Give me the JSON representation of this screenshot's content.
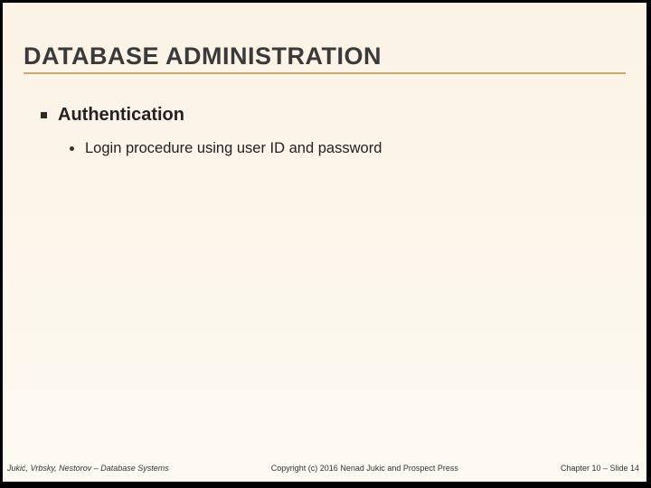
{
  "title": "DATABASE ADMINISTRATION",
  "bullets": {
    "l1": "Authentication",
    "l2": "Login procedure using user ID and password"
  },
  "footer": {
    "left": "Jukić, Vrbsky, Nestorov – Database Systems",
    "center": "Copyright (c) 2016 Nenad Jukic and Prospect Press",
    "right": "Chapter 10 – Slide 14"
  }
}
